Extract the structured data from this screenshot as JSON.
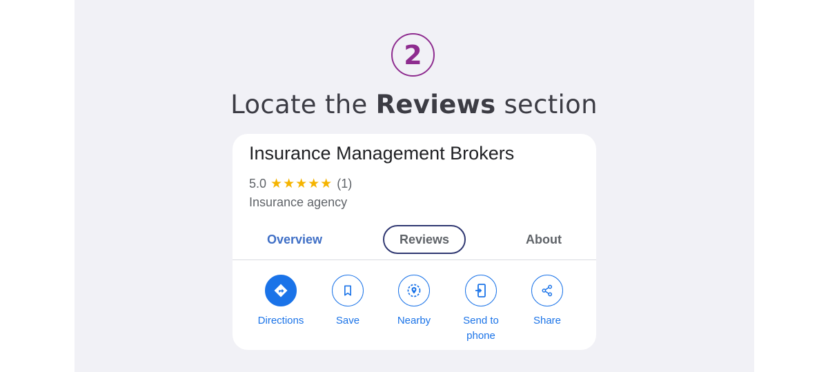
{
  "step": {
    "number": "2"
  },
  "headline": {
    "prefix": "Locate the ",
    "bold": "Reviews",
    "suffix": " section"
  },
  "business": {
    "name": "Insurance Management Brokers",
    "rating": "5.0",
    "stars": "★★★★★",
    "review_count": "(1)",
    "category": "Insurance agency"
  },
  "tabs": [
    {
      "label": "Overview"
    },
    {
      "label": "Reviews"
    },
    {
      "label": "About"
    }
  ],
  "actions": [
    {
      "label": "Directions",
      "icon": "directions-icon"
    },
    {
      "label": "Save",
      "icon": "bookmark-icon"
    },
    {
      "label": "Nearby",
      "icon": "nearby-icon"
    },
    {
      "label_line1": "Send to",
      "label_line2": "phone",
      "icon": "send-to-phone-icon"
    },
    {
      "label": "Share",
      "icon": "share-icon"
    }
  ],
  "colors": {
    "step_accent": "#8e2c8f",
    "link_blue": "#1a73e8",
    "star_yellow": "#f5b400",
    "highlight_border": "#2e3670"
  }
}
